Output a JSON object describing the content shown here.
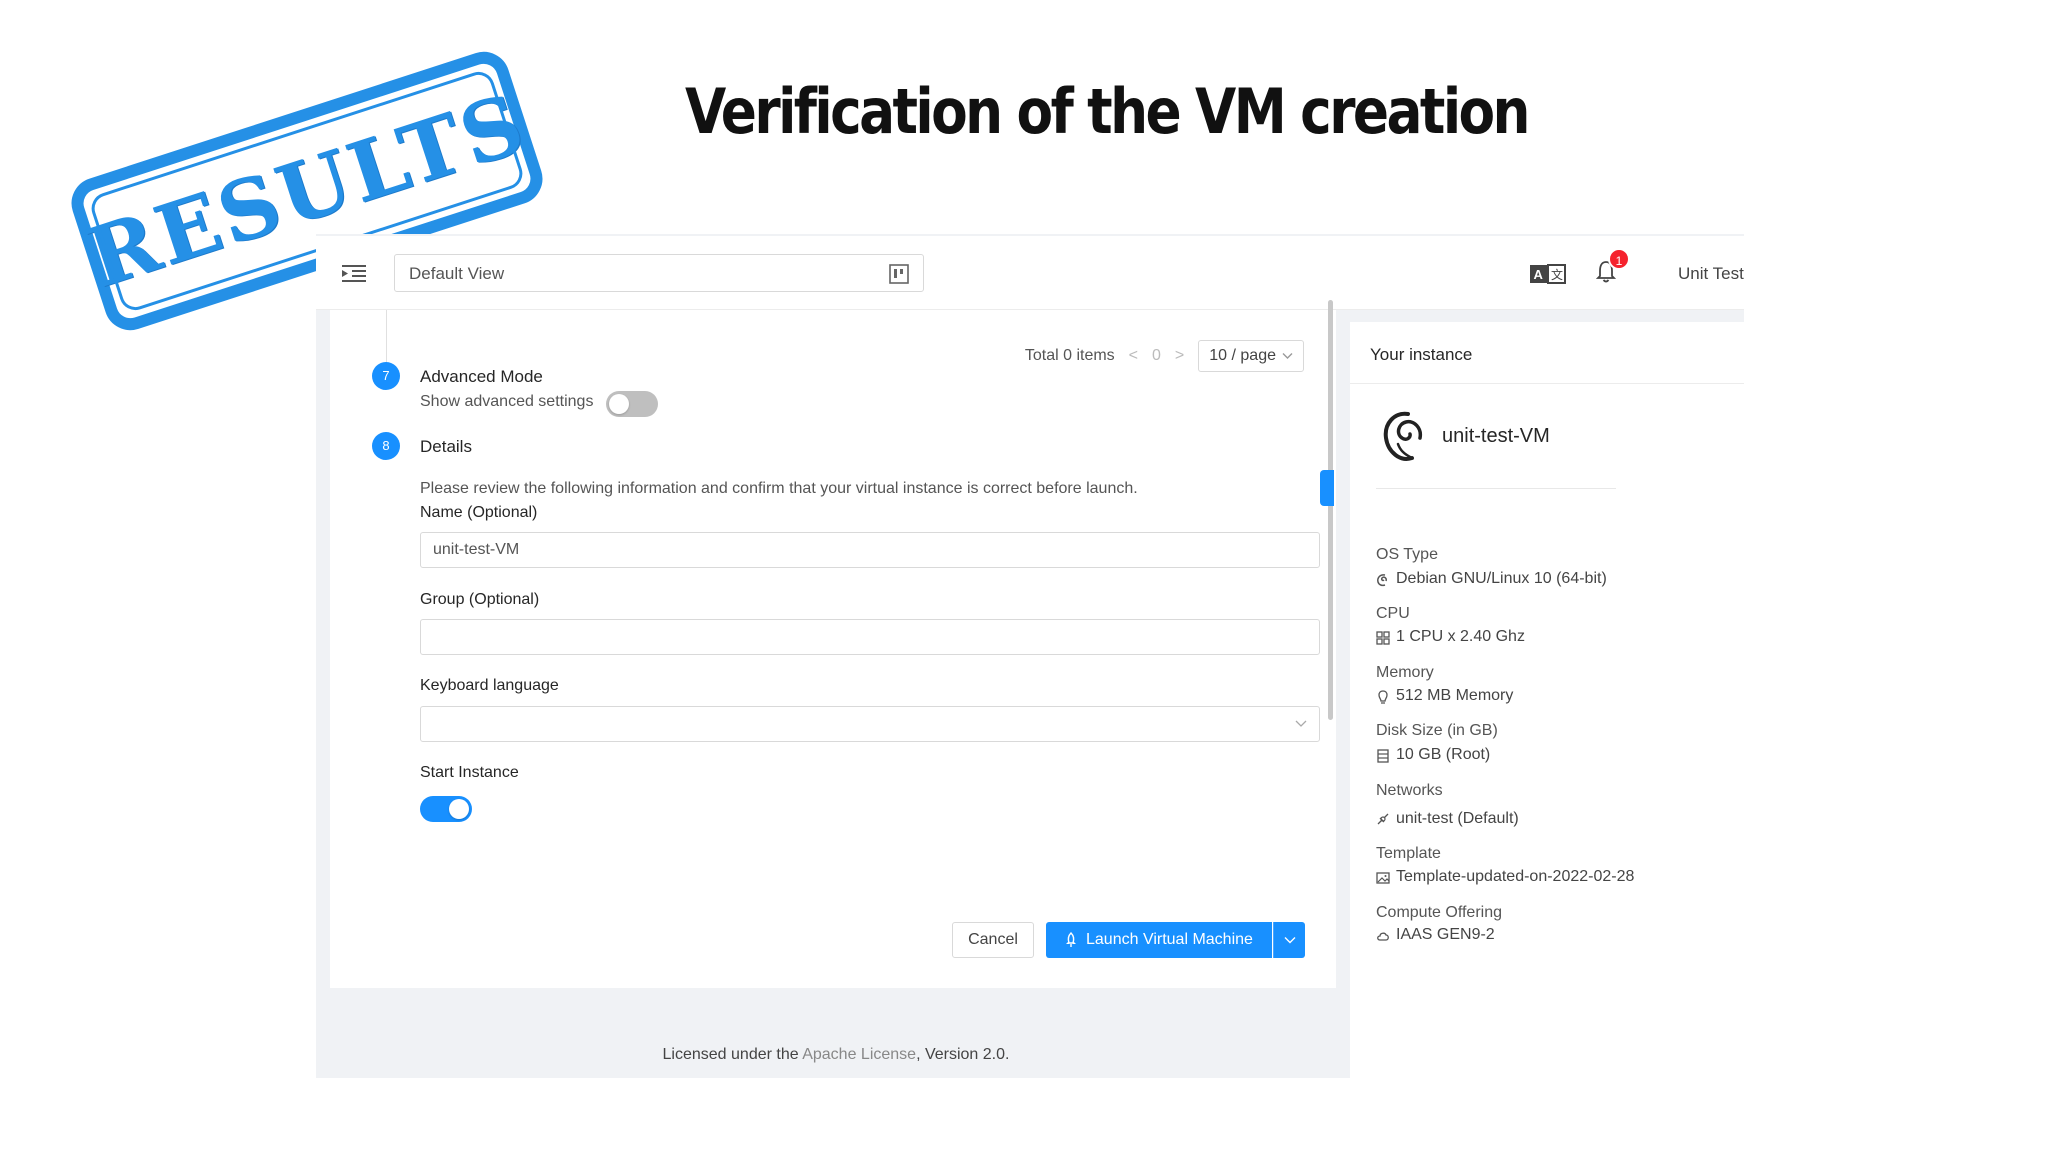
{
  "slide": {
    "title": "Verification of the VM creation",
    "stamp_text": "RESULTS"
  },
  "topbar": {
    "view_select": "Default View",
    "notification_count": "1",
    "user_name": "Unit Test"
  },
  "pagination": {
    "total": "Total 0 items",
    "prev": "<",
    "page": "0",
    "next": ">",
    "page_size": "10 / page"
  },
  "steps": [
    {
      "number": "7",
      "title": "Advanced Mode",
      "description": "Show advanced settings",
      "toggle_on": false
    },
    {
      "number": "8",
      "title": "Details",
      "description": "Please review the following information and confirm that your virtual instance is correct before launch."
    }
  ],
  "form": {
    "name_label": "Name (Optional)",
    "name_value": "unit-test-VM",
    "group_label": "Group (Optional)",
    "group_value": "",
    "keyboard_label": "Keyboard language",
    "keyboard_value": "",
    "start_label": "Start Instance",
    "start_on": true
  },
  "buttons": {
    "cancel": "Cancel",
    "launch": "Launch Virtual Machine"
  },
  "footer": {
    "prefix": "Licensed under the ",
    "link": "Apache License",
    "suffix": ", Version 2.0."
  },
  "instance": {
    "header": "Your instance",
    "name": "unit-test-VM",
    "specs": [
      {
        "label": "OS Type",
        "value": "Debian GNU/Linux 10 (64-bit)",
        "icon": "debian-icon"
      },
      {
        "label": "CPU",
        "value": "1 CPU x 2.40 Ghz",
        "icon": "cpu-icon"
      },
      {
        "label": "Memory",
        "value": "512 MB Memory",
        "icon": "memory-icon"
      },
      {
        "label": "Disk Size (in GB)",
        "value": "10 GB (Root)",
        "icon": "disk-icon"
      },
      {
        "label": "Networks",
        "value": "unit-test (Default)",
        "icon": "network-icon"
      },
      {
        "label": "Template",
        "value": "Template-updated-on-2022-02-28",
        "icon": "image-icon"
      },
      {
        "label": "Compute Offering",
        "value": "IAAS GEN9-2",
        "icon": "cloud-icon"
      }
    ]
  },
  "colors": {
    "accent": "#1890ff",
    "stamp": "#2590e6",
    "badge": "#f5222d"
  }
}
